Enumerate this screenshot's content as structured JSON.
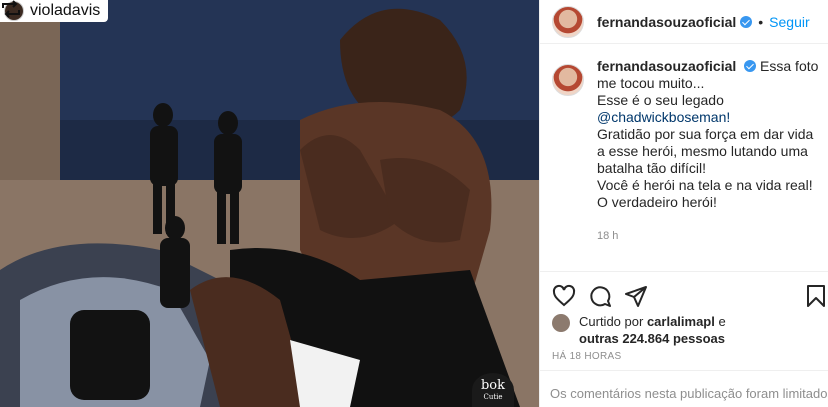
{
  "media": {
    "repost_username": "violadavis",
    "watermark_main": "bok",
    "watermark_sub": "Cutie"
  },
  "header": {
    "username": "fernandasouzaoficial",
    "separator": "•",
    "follow_label": "Seguir"
  },
  "caption": {
    "username": "fernandasouzaoficial",
    "lines": [
      "Essa foto me tocou muito...",
      "Esse é o seu legado",
      "@chadwickboseman!",
      "Gratidão por sua força em dar vida a esse herói, mesmo lutando uma batalha tão difícil!",
      "Você é herói na tela e na vida real!",
      "O verdadeiro herói!"
    ],
    "time": "18 h"
  },
  "likes": {
    "prefix": "Curtido por",
    "liker": "carlalimapl",
    "conj": "e",
    "others": "outras 224.864 pessoas"
  },
  "posted_ago": "HÁ 18 HORAS",
  "comments_limited": "Os comentários nesta publicação foram limitados."
}
